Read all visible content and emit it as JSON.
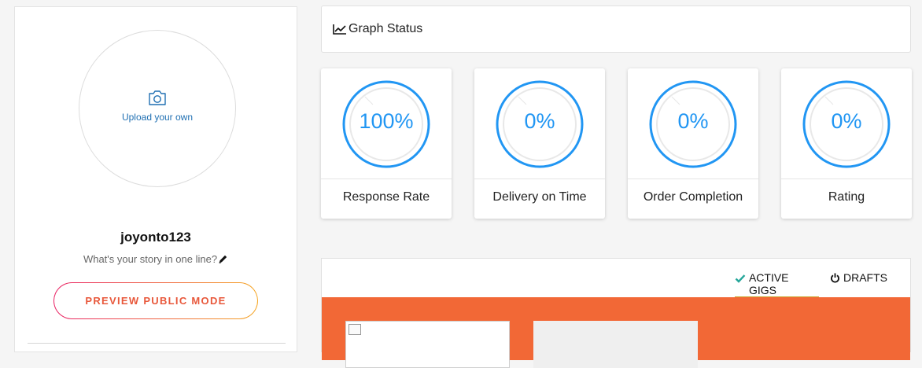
{
  "profile": {
    "upload_label": "Upload your own",
    "username": "joyonto123",
    "tagline": "What's your story in one line?",
    "preview_button": "PREVIEW PUBLIC MODE"
  },
  "graph": {
    "title": "Graph Status"
  },
  "stats": [
    {
      "label": "Response Rate",
      "value_text": "100%",
      "value": 100
    },
    {
      "label": "Delivery on Time",
      "value_text": "0%",
      "value": 0
    },
    {
      "label": "Order Completion",
      "value_text": "0%",
      "value": 0
    },
    {
      "label": "Rating",
      "value_text": "0%",
      "value": 0
    }
  ],
  "gigs": {
    "tabs": [
      {
        "label": "ACTIVE GIGS",
        "icon": "check-icon",
        "active": true
      },
      {
        "label": "DRAFTS",
        "icon": "power-icon",
        "active": false
      }
    ]
  },
  "colors": {
    "accent_blue": "#2196f3",
    "gigs_band": "#f26836",
    "preview_text": "#e8583b",
    "active_tab_underline": "#c9a227",
    "check_green": "#26a69a"
  }
}
